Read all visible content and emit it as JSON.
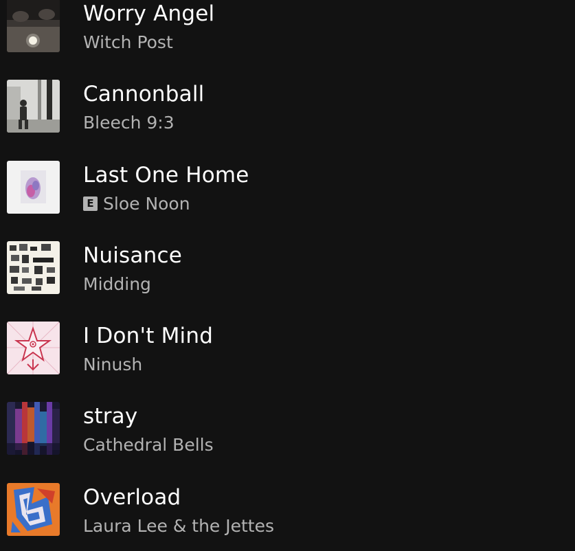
{
  "tracks": [
    {
      "title": "Worry Angel",
      "artist": "Witch Post",
      "explicit": false,
      "art_icon": "worry-angel-cover"
    },
    {
      "title": "Cannonball",
      "artist": "Bleech 9:3",
      "explicit": false,
      "art_icon": "cannonball-cover"
    },
    {
      "title": "Last One Home",
      "artist": "Sloe Noon",
      "explicit": true,
      "explicit_label": "E",
      "art_icon": "last-one-home-cover"
    },
    {
      "title": "Nuisance",
      "artist": "Midding",
      "explicit": false,
      "art_icon": "nuisance-cover"
    },
    {
      "title": "I Don't Mind",
      "artist": "Ninush",
      "explicit": false,
      "art_icon": "i-dont-mind-cover"
    },
    {
      "title": "stray",
      "artist": "Cathedral Bells",
      "explicit": false,
      "art_icon": "stray-cover"
    },
    {
      "title": "Overload",
      "artist": "Laura Lee & the Jettes",
      "explicit": false,
      "art_icon": "overload-cover"
    }
  ],
  "colors": {
    "background": "#121212",
    "title": "#ffffff",
    "artist": "#b3b3b3"
  }
}
